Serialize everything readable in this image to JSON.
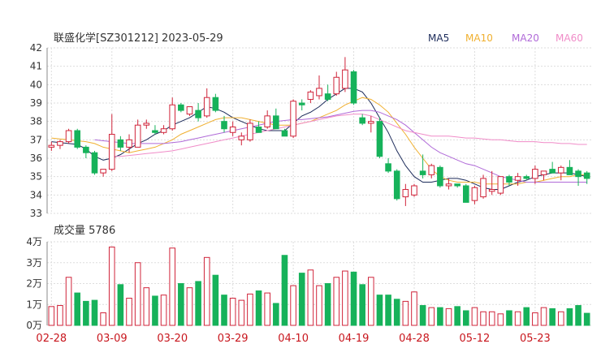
{
  "title": "联盛化学[SZ301212] 2023-05-29",
  "legend": [
    {
      "name": "MA5",
      "color": "#1c2b5a"
    },
    {
      "name": "MA10",
      "color": "#f0b030"
    },
    {
      "name": "MA20",
      "color": "#b06ad8"
    },
    {
      "name": "MA60",
      "color": "#f08cc8"
    }
  ],
  "volume_title": "成交量 5786",
  "colors": {
    "up": "#d0243a",
    "down": "#16b25a",
    "grid": "#dddddd",
    "axis_text": "#333333",
    "date_text": "#c8161d"
  },
  "chart_data": [
    {
      "type": "candlestick",
      "title": "联盛化学[SZ301212] 2023-05-29",
      "ylim": [
        33,
        42
      ],
      "yticks": [
        33,
        34,
        35,
        36,
        37,
        38,
        39,
        40,
        41,
        42
      ],
      "xticks": [
        "02-28",
        "03-09",
        "03-20",
        "03-29",
        "04-10",
        "04-19",
        "04-28",
        "05-12",
        "05-23"
      ],
      "xtick_index": [
        0,
        7,
        14,
        21,
        28,
        35,
        42,
        49,
        56
      ],
      "ohlc": [
        [
          36.6,
          36.9,
          36.4,
          36.7
        ],
        [
          36.7,
          37.0,
          36.5,
          36.9
        ],
        [
          36.9,
          37.6,
          36.8,
          37.5
        ],
        [
          37.5,
          37.6,
          36.5,
          36.6
        ],
        [
          36.6,
          36.7,
          36.0,
          36.3
        ],
        [
          36.3,
          36.4,
          35.1,
          35.2
        ],
        [
          35.2,
          35.4,
          35.0,
          35.4
        ],
        [
          35.4,
          38.4,
          35.3,
          37.3
        ],
        [
          37.0,
          37.2,
          36.4,
          36.6
        ],
        [
          36.6,
          37.3,
          36.3,
          37.0
        ],
        [
          36.6,
          38.1,
          36.6,
          37.8
        ],
        [
          37.8,
          38.1,
          37.6,
          37.9
        ],
        [
          37.5,
          37.8,
          37.3,
          37.4
        ],
        [
          37.4,
          37.8,
          37.3,
          37.6
        ],
        [
          37.6,
          39.3,
          37.5,
          38.9
        ],
        [
          38.9,
          39.0,
          38.5,
          38.6
        ],
        [
          38.4,
          38.8,
          38.3,
          38.8
        ],
        [
          38.6,
          39.0,
          38.0,
          38.2
        ],
        [
          38.3,
          39.8,
          38.2,
          39.3
        ],
        [
          39.3,
          39.5,
          38.5,
          38.6
        ],
        [
          38.0,
          38.3,
          37.4,
          37.6
        ],
        [
          37.4,
          38.0,
          37.2,
          37.7
        ],
        [
          37.0,
          37.4,
          36.7,
          37.2
        ],
        [
          37.0,
          38.1,
          36.9,
          37.9
        ],
        [
          37.7,
          38.0,
          37.4,
          37.4
        ],
        [
          37.7,
          38.6,
          37.6,
          38.3
        ],
        [
          38.3,
          38.7,
          37.6,
          37.6
        ],
        [
          37.5,
          37.6,
          37.2,
          37.2
        ],
        [
          37.2,
          39.2,
          37.1,
          39.1
        ],
        [
          39.0,
          39.2,
          38.6,
          38.9
        ],
        [
          39.2,
          39.7,
          39.0,
          39.6
        ],
        [
          39.4,
          40.5,
          39.2,
          39.8
        ],
        [
          39.5,
          40.0,
          39.1,
          39.2
        ],
        [
          39.5,
          40.7,
          39.4,
          40.4
        ],
        [
          39.8,
          41.5,
          39.6,
          40.8
        ],
        [
          40.7,
          40.8,
          38.9,
          39.0
        ],
        [
          38.2,
          38.4,
          37.8,
          37.9
        ],
        [
          37.9,
          38.3,
          37.4,
          38.0
        ],
        [
          38.0,
          38.2,
          36.0,
          36.1
        ],
        [
          35.7,
          36.0,
          35.2,
          35.3
        ],
        [
          35.3,
          35.4,
          33.7,
          33.8
        ],
        [
          33.9,
          34.6,
          33.4,
          34.3
        ],
        [
          34.0,
          34.6,
          33.9,
          34.5
        ],
        [
          35.3,
          36.2,
          34.9,
          35.1
        ],
        [
          35.1,
          35.7,
          34.9,
          35.6
        ],
        [
          35.5,
          35.6,
          34.4,
          34.5
        ],
        [
          34.5,
          34.9,
          34.3,
          34.6
        ],
        [
          34.6,
          34.6,
          34.4,
          34.5
        ],
        [
          34.5,
          34.6,
          33.6,
          33.6
        ],
        [
          33.7,
          34.5,
          33.5,
          34.4
        ],
        [
          33.9,
          35.1,
          33.8,
          34.9
        ],
        [
          34.2,
          35.3,
          34.0,
          34.3
        ],
        [
          34.1,
          35.0,
          34.0,
          35.0
        ],
        [
          35.0,
          35.1,
          34.5,
          34.7
        ],
        [
          34.8,
          35.2,
          34.5,
          35.0
        ],
        [
          35.0,
          35.1,
          34.8,
          34.9
        ],
        [
          34.9,
          35.6,
          34.6,
          35.4
        ],
        [
          35.1,
          35.3,
          34.8,
          35.3
        ],
        [
          35.4,
          35.8,
          35.2,
          35.2
        ],
        [
          35.2,
          35.6,
          34.8,
          35.5
        ],
        [
          35.5,
          35.9,
          35.2,
          35.1
        ],
        [
          35.3,
          35.4,
          34.5,
          35.0
        ],
        [
          35.2,
          35.3,
          34.6,
          34.9
        ]
      ],
      "series": [
        {
          "name": "MA5",
          "values": [
            36.9,
            36.85,
            36.8,
            36.75,
            36.5,
            36.1,
            35.9,
            36.0,
            36.2,
            36.5,
            36.8,
            37.0,
            37.3,
            37.5,
            37.8,
            38.0,
            38.2,
            38.5,
            38.8,
            38.7,
            38.5,
            38.2,
            38.0,
            37.8,
            37.6,
            37.5,
            37.5,
            37.5,
            37.9,
            38.3,
            38.5,
            38.8,
            39.2,
            39.5,
            39.8,
            39.8,
            39.6,
            39.0,
            38.2,
            37.4,
            36.4,
            35.6,
            35.0,
            34.7,
            34.7,
            34.8,
            34.9,
            34.9,
            34.8,
            34.6,
            34.4,
            34.3,
            34.3,
            34.5,
            34.7,
            34.8,
            35.0,
            35.1,
            35.2,
            35.2,
            35.2,
            35.1,
            35.0
          ]
        },
        {
          "name": "MA10",
          "values": [
            37.1,
            37.05,
            37.0,
            36.95,
            36.9,
            36.8,
            36.6,
            36.5,
            36.4,
            36.3,
            36.4,
            36.5,
            36.6,
            36.8,
            37.0,
            37.3,
            37.5,
            37.7,
            37.9,
            38.1,
            38.2,
            38.2,
            38.2,
            38.1,
            38.0,
            37.9,
            37.8,
            37.8,
            37.8,
            37.9,
            38.0,
            38.2,
            38.4,
            38.6,
            38.9,
            39.1,
            39.3,
            39.2,
            38.9,
            38.5,
            37.9,
            37.3,
            36.6,
            36.0,
            35.4,
            35.0,
            34.8,
            34.7,
            34.7,
            34.7,
            34.6,
            34.6,
            34.6,
            34.6,
            34.6,
            34.7,
            34.7,
            34.8,
            34.9,
            35.0,
            35.0,
            35.1,
            35.1
          ]
        },
        {
          "name": "MA20",
          "values": [
            null,
            null,
            null,
            null,
            null,
            37.0,
            36.95,
            36.9,
            36.85,
            36.8,
            36.8,
            36.8,
            36.8,
            36.8,
            36.85,
            36.9,
            37.0,
            37.1,
            37.2,
            37.3,
            37.4,
            37.5,
            37.6,
            37.7,
            37.8,
            37.9,
            38.0,
            38.05,
            38.1,
            38.1,
            38.15,
            38.2,
            38.25,
            38.35,
            38.45,
            38.55,
            38.6,
            38.6,
            38.5,
            38.3,
            38.1,
            37.8,
            37.4,
            37.0,
            36.6,
            36.3,
            36.1,
            35.9,
            35.7,
            35.6,
            35.4,
            35.2,
            35.0,
            34.9,
            34.8,
            34.7,
            34.7,
            34.7,
            34.7,
            34.7,
            34.7,
            34.7,
            34.7
          ]
        },
        {
          "name": "MA60",
          "values": [
            null,
            null,
            null,
            null,
            null,
            null,
            null,
            36.1,
            36.1,
            36.15,
            36.2,
            36.25,
            36.3,
            36.35,
            36.4,
            36.5,
            36.6,
            36.7,
            36.8,
            36.9,
            37.0,
            37.1,
            37.2,
            37.3,
            37.4,
            37.5,
            37.6,
            37.7,
            37.8,
            37.9,
            38.0,
            38.1,
            38.2,
            38.3,
            38.35,
            38.4,
            38.4,
            38.3,
            38.1,
            37.9,
            37.7,
            37.5,
            37.4,
            37.3,
            37.2,
            37.2,
            37.2,
            37.15,
            37.1,
            37.1,
            37.05,
            37.0,
            37.0,
            36.95,
            36.9,
            36.9,
            36.9,
            36.85,
            36.85,
            36.8,
            36.8,
            36.75,
            36.75
          ]
        }
      ]
    },
    {
      "type": "bar",
      "title": "成交量 5786",
      "unit": "万",
      "ylim": [
        0,
        40000
      ],
      "yticks": [
        "0万",
        "1万",
        "2万",
        "3万",
        "4万"
      ],
      "values": [
        9000,
        9500,
        23000,
        15500,
        11500,
        12000,
        6000,
        37500,
        19500,
        13000,
        30000,
        18000,
        14000,
        14500,
        37000,
        20000,
        18000,
        21000,
        32500,
        24000,
        14500,
        13000,
        12000,
        15000,
        16500,
        15500,
        10500,
        33500,
        19000,
        25000,
        26500,
        19000,
        20000,
        23000,
        26000,
        25500,
        19500,
        23000,
        14500,
        14500,
        12500,
        11500,
        16000,
        9500,
        8500,
        8500,
        8000,
        9000,
        7000,
        8500,
        6500,
        6500,
        5500,
        7000,
        6500,
        8500,
        6000,
        8500,
        8000,
        6500,
        8000,
        9500,
        5786
      ]
    }
  ]
}
